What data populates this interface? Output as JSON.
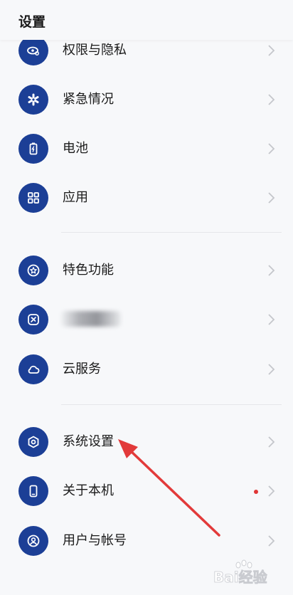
{
  "header": {
    "title": "设置"
  },
  "items": [
    {
      "label": "权限与隐私",
      "icon": "privacy-eye-icon"
    },
    {
      "label": "紧急情况",
      "icon": "emergency-asterisk-icon"
    },
    {
      "label": "电池",
      "icon": "battery-icon"
    },
    {
      "label": "应用",
      "icon": "apps-grid-icon"
    },
    {
      "label": "特色功能",
      "icon": "star-circle-icon"
    },
    {
      "label": "",
      "icon": "wallet-icon"
    },
    {
      "label": "云服务",
      "icon": "cloud-icon"
    },
    {
      "label": "系统设置",
      "icon": "hexagon-settings-icon"
    },
    {
      "label": "关于本机",
      "icon": "phone-icon"
    },
    {
      "label": "用户与帐号",
      "icon": "user-icon"
    }
  ],
  "watermark": {
    "text": "Bai经验"
  },
  "colors": {
    "icon_bg": "#1c3f96",
    "badge": "#e03535",
    "annotation_arrow": "#e23a3a"
  }
}
